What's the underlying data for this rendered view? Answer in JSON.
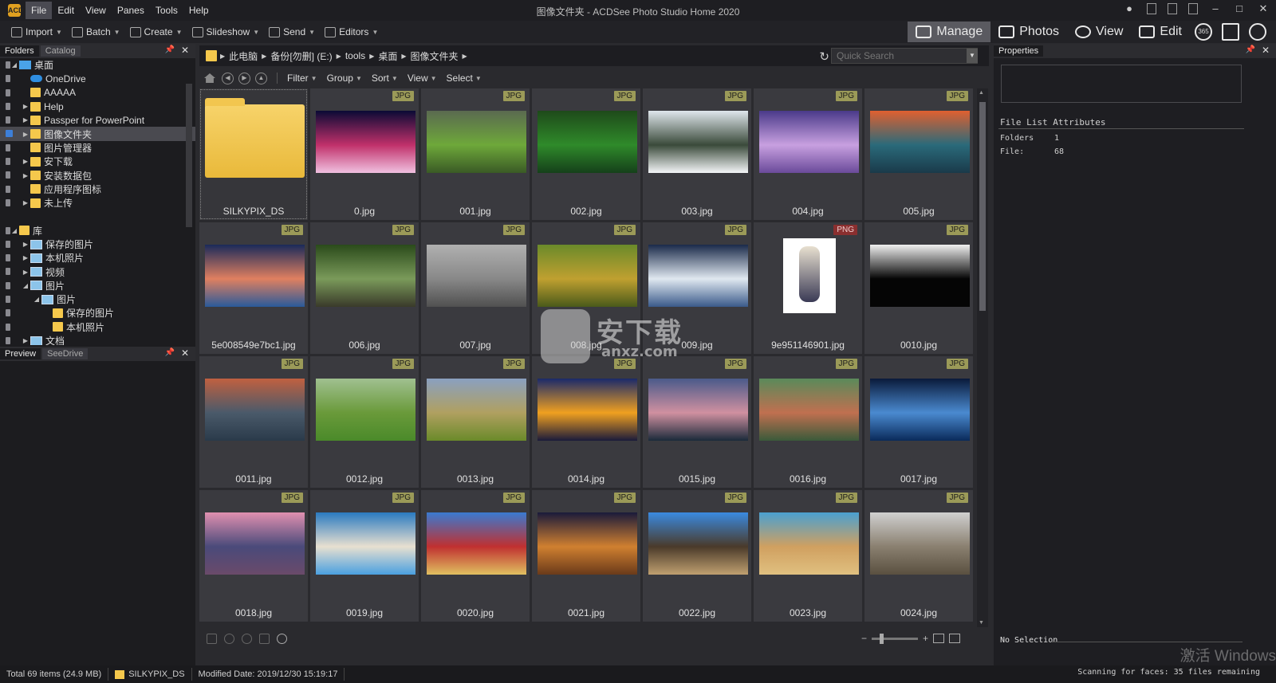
{
  "window": {
    "title": "图像文件夹 - ACDSee Photo Studio Home 2020",
    "logo_label": "ACD",
    "menu": [
      "File",
      "Edit",
      "View",
      "Panes",
      "Tools",
      "Help"
    ],
    "active_menu": "File"
  },
  "toolbar": {
    "items": [
      "Import",
      "Batch",
      "Create",
      "Slideshow",
      "Send",
      "Editors"
    ],
    "modes": [
      "Manage",
      "Photos",
      "View",
      "Edit"
    ],
    "active_mode": "Manage",
    "badge_365": "365"
  },
  "left_panel": {
    "tabs": [
      "Folders",
      "Catalog"
    ],
    "tree": [
      {
        "label": "桌面",
        "icon": "desktop",
        "level": 1,
        "expanded": true
      },
      {
        "label": "OneDrive",
        "icon": "cloud",
        "level": 2
      },
      {
        "label": "AAAAA",
        "icon": "folder",
        "level": 2
      },
      {
        "label": "Help",
        "icon": "folder",
        "level": 2,
        "has_children": true
      },
      {
        "label": "Passper for PowerPoint",
        "icon": "folder",
        "level": 2,
        "has_children": true
      },
      {
        "label": "图像文件夹",
        "icon": "folder",
        "level": 2,
        "has_children": true,
        "selected": true
      },
      {
        "label": "图片管理器",
        "icon": "folder",
        "level": 2
      },
      {
        "label": "安下载",
        "icon": "folder",
        "level": 2,
        "has_children": true
      },
      {
        "label": "安装数据包",
        "icon": "folder",
        "level": 2,
        "has_children": true
      },
      {
        "label": "应用程序图标",
        "icon": "folder",
        "level": 2
      },
      {
        "label": "未上传",
        "icon": "folder",
        "level": 2,
        "has_children": true
      },
      {
        "label": "",
        "icon": "none",
        "level": 0
      },
      {
        "label": "库",
        "icon": "folder",
        "level": 1,
        "expanded": true
      },
      {
        "label": "保存的图片",
        "icon": "library",
        "level": 2,
        "has_children": true
      },
      {
        "label": "本机照片",
        "icon": "library",
        "level": 2,
        "has_children": true
      },
      {
        "label": "视频",
        "icon": "library",
        "level": 2,
        "has_children": true
      },
      {
        "label": "图片",
        "icon": "library",
        "level": 2,
        "expanded": true
      },
      {
        "label": "图片",
        "icon": "library",
        "level": 3,
        "expanded": true
      },
      {
        "label": "保存的图片",
        "icon": "folder",
        "level": 4
      },
      {
        "label": "本机照片",
        "icon": "folder",
        "level": 4
      },
      {
        "label": "文档",
        "icon": "library",
        "level": 2,
        "has_children": true
      }
    ],
    "preview_tabs": [
      "Preview",
      "SeeDrive"
    ]
  },
  "address": {
    "crumbs": [
      "此电脑",
      "备份[勿删] (E:)",
      "tools",
      "桌面",
      "图像文件夹"
    ],
    "search_placeholder": "Quick Search"
  },
  "nav": {
    "menus": [
      "Filter",
      "Group",
      "Sort",
      "View",
      "Select"
    ]
  },
  "files": [
    {
      "name": "SILKYPIX_DS",
      "type": "",
      "kind": "folder"
    },
    {
      "name": "0.jpg",
      "type": "JPG",
      "kind": "photo",
      "colors": [
        "#0a0a35",
        "#c0306a",
        "#f0c0e0"
      ]
    },
    {
      "name": "001.jpg",
      "type": "JPG",
      "kind": "photo",
      "colors": [
        "#5a6a50",
        "#6ea83a",
        "#3a5a25"
      ]
    },
    {
      "name": "002.jpg",
      "type": "JPG",
      "kind": "photo",
      "colors": [
        "#1e4a1a",
        "#2f8a2a",
        "#15401a"
      ]
    },
    {
      "name": "003.jpg",
      "type": "JPG",
      "kind": "photo",
      "colors": [
        "#dfe6ec",
        "#3a4a3a",
        "#f4f6f8"
      ]
    },
    {
      "name": "004.jpg",
      "type": "JPG",
      "kind": "photo",
      "colors": [
        "#4a3a8a",
        "#c8a0e0",
        "#6a4a9a"
      ]
    },
    {
      "name": "005.jpg",
      "type": "JPG",
      "kind": "photo",
      "colors": [
        "#e06030",
        "#2a6a7a",
        "#1a3a4a"
      ]
    },
    {
      "name": "5e008549e7bc1.jpg",
      "type": "JPG",
      "kind": "photo",
      "colors": [
        "#1a2a5a",
        "#e08060",
        "#2a5a9a"
      ]
    },
    {
      "name": "006.jpg",
      "type": "JPG",
      "kind": "photo",
      "colors": [
        "#2a4a1a",
        "#7a9a5a",
        "#3a3a2a"
      ]
    },
    {
      "name": "007.jpg",
      "type": "JPG",
      "kind": "photo",
      "colors": [
        "#b0b0b0",
        "#888888",
        "#505050"
      ]
    },
    {
      "name": "008.jpg",
      "type": "JPG",
      "kind": "photo",
      "colors": [
        "#6a8a2a",
        "#c0a030",
        "#4a5a1a"
      ]
    },
    {
      "name": "009.jpg",
      "type": "JPG",
      "kind": "photo",
      "colors": [
        "#1a2a4a",
        "#e0e8f0",
        "#3a5a8a"
      ]
    },
    {
      "name": "9e951146901.jpg",
      "type": "PNG",
      "kind": "tall"
    },
    {
      "name": "0010.jpg",
      "type": "JPG",
      "kind": "photo",
      "colors": [
        "#f0f0f0",
        "#050505",
        "#050505"
      ]
    },
    {
      "name": "0011.jpg",
      "type": "JPG",
      "kind": "photo",
      "colors": [
        "#c06040",
        "#4a5a6a",
        "#2a3a4a"
      ]
    },
    {
      "name": "0012.jpg",
      "type": "JPG",
      "kind": "photo",
      "colors": [
        "#a0c090",
        "#6a9a3a",
        "#4a8a2a"
      ]
    },
    {
      "name": "0013.jpg",
      "type": "JPG",
      "kind": "photo",
      "colors": [
        "#8aa0c0",
        "#b0a060",
        "#6a8a2a"
      ]
    },
    {
      "name": "0014.jpg",
      "type": "JPG",
      "kind": "photo",
      "colors": [
        "#1a2a6a",
        "#f0a020",
        "#1a1a3a"
      ]
    },
    {
      "name": "0015.jpg",
      "type": "JPG",
      "kind": "photo",
      "colors": [
        "#4a5a8a",
        "#d090a0",
        "#1a2a3a"
      ]
    },
    {
      "name": "0016.jpg",
      "type": "JPG",
      "kind": "photo",
      "colors": [
        "#5a8a5a",
        "#c07050",
        "#3a5a3a"
      ]
    },
    {
      "name": "0017.jpg",
      "type": "JPG",
      "kind": "photo",
      "colors": [
        "#0a1a3a",
        "#4a8ad0",
        "#0a2a5a"
      ]
    },
    {
      "name": "0018.jpg",
      "type": "JPG",
      "kind": "photo",
      "colors": [
        "#e090b0",
        "#4a4a7a",
        "#6a4a6a"
      ]
    },
    {
      "name": "0019.jpg",
      "type": "JPG",
      "kind": "photo",
      "colors": [
        "#2a7ac0",
        "#e8e0d0",
        "#4aa0e0"
      ]
    },
    {
      "name": "0020.jpg",
      "type": "JPG",
      "kind": "photo",
      "colors": [
        "#3a7ad0",
        "#c03030",
        "#e0c060"
      ]
    },
    {
      "name": "0021.jpg",
      "type": "JPG",
      "kind": "photo",
      "colors": [
        "#1a1a3a",
        "#d08030",
        "#6a3a1a"
      ]
    },
    {
      "name": "0022.jpg",
      "type": "JPG",
      "kind": "photo",
      "colors": [
        "#3a8ae0",
        "#4a3a2a",
        "#c0a070"
      ]
    },
    {
      "name": "0023.jpg",
      "type": "JPG",
      "kind": "photo",
      "colors": [
        "#4aa0d0",
        "#d0a060",
        "#e0c080"
      ]
    },
    {
      "name": "0024.jpg",
      "type": "JPG",
      "kind": "photo",
      "colors": [
        "#d0d0d0",
        "#8a8070",
        "#5a5040"
      ]
    }
  ],
  "watermark": {
    "text": "安下载",
    "sub": "anxz.com"
  },
  "right_panel": {
    "title": "Properties",
    "section_title": "File List Attributes",
    "attributes": [
      {
        "label": "Folders",
        "value": "1"
      },
      {
        "label": "File:",
        "value": "68"
      }
    ],
    "no_selection": "No Selection"
  },
  "status": {
    "total": "Total 69 items  (24.9 MB)",
    "folder": "SILKYPIX_DS",
    "modified": "Modified Date: 2019/12/30 15:19:17",
    "scan": "Scanning for faces: 35 files remaining",
    "activate": "激活 Windows"
  }
}
